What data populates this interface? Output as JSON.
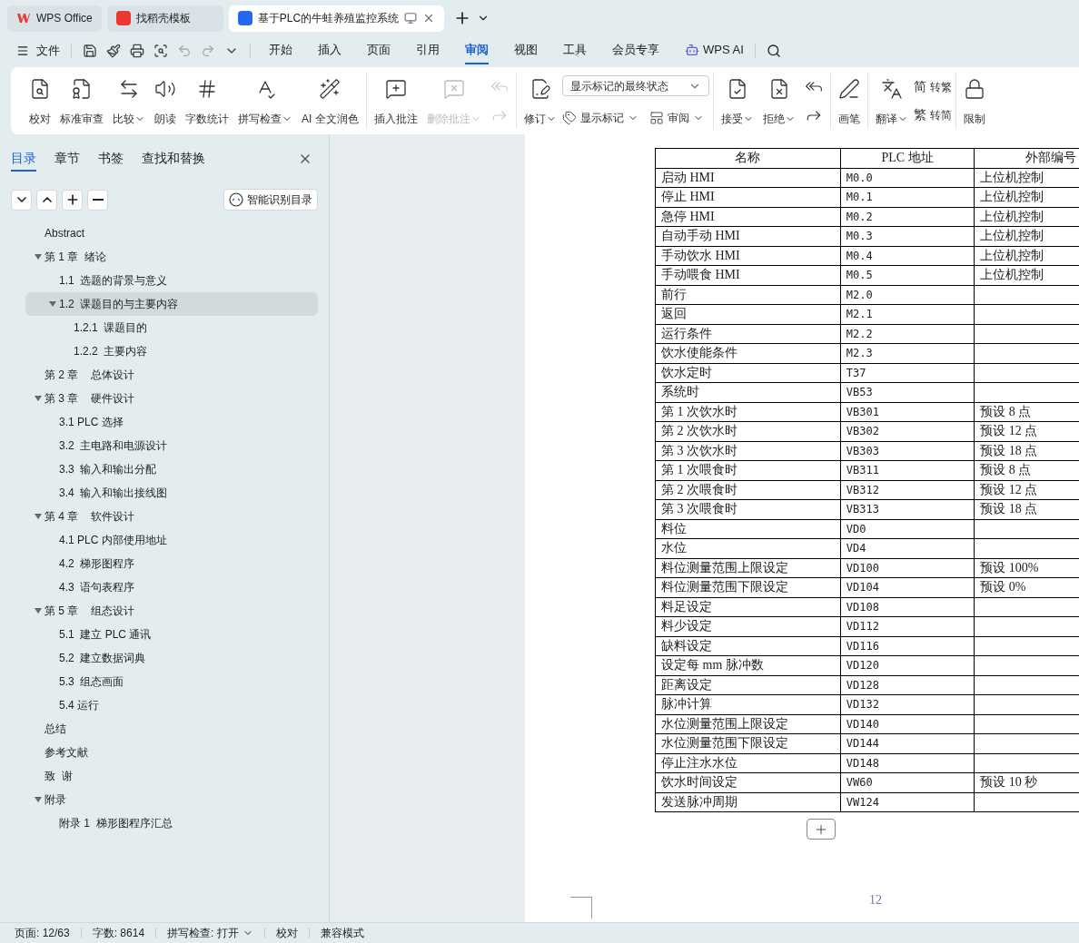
{
  "title_tabs": [
    {
      "label": "WPS Office",
      "selected": false
    },
    {
      "label": "找稻壳模板",
      "selected": false
    },
    {
      "label": "基于PLC的牛蛙养殖监控系统",
      "selected": true
    }
  ],
  "menu": {
    "file": "文件",
    "tabs": [
      {
        "label": "开始",
        "selected": false
      },
      {
        "label": "插入",
        "selected": false
      },
      {
        "label": "页面",
        "selected": false
      },
      {
        "label": "引用",
        "selected": false
      },
      {
        "label": "审阅",
        "selected": true
      },
      {
        "label": "视图",
        "selected": false
      },
      {
        "label": "工具",
        "selected": false
      },
      {
        "label": "会员专享",
        "selected": false
      },
      {
        "label": "WPS AI",
        "selected": false
      }
    ]
  },
  "ribbon": [
    {
      "items": [
        {
          "kind": "big",
          "label": "校对",
          "dropdown": false,
          "disabled": false
        },
        {
          "kind": "big",
          "label": "标准审查",
          "dropdown": false,
          "disabled": false
        },
        {
          "kind": "big",
          "label": "比较",
          "dropdown": true,
          "disabled": false
        },
        {
          "kind": "big",
          "label": "朗读",
          "dropdown": false,
          "disabled": false
        },
        {
          "kind": "big",
          "label": "字数统计",
          "dropdown": false,
          "disabled": false
        },
        {
          "kind": "big",
          "label": "拼写检查",
          "dropdown": true,
          "disabled": false
        },
        {
          "kind": "big",
          "label": "AI 全文润色",
          "dropdown": false,
          "disabled": false
        }
      ]
    },
    {
      "items": [
        {
          "kind": "big",
          "label": "插入批注",
          "dropdown": false,
          "disabled": false
        },
        {
          "kind": "big",
          "label": "删除批注",
          "dropdown": true,
          "disabled": true
        },
        {
          "kind": "icons",
          "disabled": true
        }
      ]
    },
    {
      "items": [
        {
          "kind": "big",
          "label": "修订",
          "dropdown": true,
          "disabled": false
        },
        {
          "kind": "select",
          "value": "显示标记的最终状态",
          "buttons": [
            {
              "label": "显示标记",
              "dropdown": true
            },
            {
              "label": "审阅",
              "dropdown": true
            }
          ]
        }
      ]
    },
    {
      "items": [
        {
          "kind": "big",
          "label": "接受",
          "dropdown": true,
          "disabled": false
        },
        {
          "kind": "big",
          "label": "拒绝",
          "dropdown": true,
          "disabled": false
        },
        {
          "kind": "icons",
          "disabled": false
        }
      ]
    },
    {
      "items": [
        {
          "kind": "big",
          "label": "画笔",
          "dropdown": false,
          "disabled": false
        }
      ]
    },
    {
      "items": [
        {
          "kind": "big",
          "label": "翻译",
          "dropdown": true,
          "disabled": false
        },
        {
          "kind": "convert",
          "buttons": [
            {
              "glyph": "简",
              "label": "转繁"
            },
            {
              "glyph": "繁",
              "label": "转简"
            }
          ]
        }
      ]
    },
    {
      "items": [
        {
          "kind": "big",
          "label": "限制",
          "dropdown": false,
          "disabled": false
        }
      ]
    }
  ],
  "sidebar": {
    "tabs": [
      {
        "label": "目录",
        "selected": true
      },
      {
        "label": "章节",
        "selected": false
      },
      {
        "label": "书签",
        "selected": false
      },
      {
        "label": "查找和替换",
        "selected": false
      }
    ],
    "smart_button": "智能识别目录",
    "toc": [
      {
        "label": "Abstract",
        "selected": false
      },
      {
        "label": "第 1 章  绪论",
        "expanded": true,
        "selected": false,
        "children": [
          {
            "label": "1.1  选题的背景与意义",
            "selected": false
          },
          {
            "label": "1.2  课题目的与主要内容",
            "expanded": true,
            "selected": true,
            "children": [
              {
                "label": "1.2.1  课题目的",
                "selected": false
              },
              {
                "label": "1.2.2  主要内容",
                "selected": false
              }
            ]
          }
        ]
      },
      {
        "label": "第 2 章    总体设计",
        "selected": false
      },
      {
        "label": "第 3 章    硬件设计",
        "expanded": true,
        "selected": false,
        "children": [
          {
            "label": "3.1 PLC 选择",
            "selected": false
          },
          {
            "label": "3.2  主电路和电源设计",
            "selected": false
          },
          {
            "label": "3.3  输入和输出分配",
            "selected": false
          },
          {
            "label": "3.4  输入和输出接线图",
            "selected": false
          }
        ]
      },
      {
        "label": "第 4 章    软件设计",
        "expanded": true,
        "selected": false,
        "children": [
          {
            "label": "4.1 PLC 内部使用地址",
            "selected": false
          },
          {
            "label": "4.2  梯形图程序",
            "selected": false
          },
          {
            "label": "4.3  语句表程序",
            "selected": false
          }
        ]
      },
      {
        "label": "第 5 章    组态设计",
        "expanded": true,
        "selected": false,
        "children": [
          {
            "label": "5.1  建立 PLC 通讯",
            "selected": false
          },
          {
            "label": "5.2  建立数据词典",
            "selected": false
          },
          {
            "label": "5.3  组态画面",
            "selected": false
          },
          {
            "label": "5.4 运行",
            "selected": false
          }
        ]
      },
      {
        "label": "总结",
        "selected": false
      },
      {
        "label": "参考文献",
        "selected": false
      },
      {
        "label": "致  谢",
        "selected": false
      },
      {
        "label": "附录",
        "expanded": true,
        "selected": false,
        "children": [
          {
            "label": "附录 1  梯形图程序汇总",
            "selected": false
          }
        ]
      }
    ]
  },
  "table": {
    "columns": [
      "名称",
      "PLC 地址",
      "外部编号"
    ],
    "rows": [
      [
        "启动 HMI",
        "M0.0",
        "上位机控制"
      ],
      [
        "停止 HMI",
        "M0.1",
        "上位机控制"
      ],
      [
        "急停 HMI",
        "M0.2",
        "上位机控制"
      ],
      [
        "自动手动 HMI",
        "M0.3",
        "上位机控制"
      ],
      [
        "手动饮水 HMI",
        "M0.4",
        "上位机控制"
      ],
      [
        "手动喂食 HMI",
        "M0.5",
        "上位机控制"
      ],
      [
        "前行",
        "M2.0"
      ],
      [
        "返回",
        "M2.1"
      ],
      [
        "运行条件",
        "M2.2"
      ],
      [
        "饮水使能条件",
        "M2.3"
      ],
      [
        "饮水定时",
        "T37"
      ],
      [
        "系统时",
        "VB53"
      ],
      [
        "第 1 次饮水时",
        "VB301",
        "预设 8 点"
      ],
      [
        "第 2 次饮水时",
        "VB302",
        "预设 12 点"
      ],
      [
        "第 3 次饮水时",
        "VB303",
        "预设 18 点"
      ],
      [
        "第 1 次喂食时",
        "VB311",
        "预设 8 点"
      ],
      [
        "第 2 次喂食时",
        "VB312",
        "预设 12 点"
      ],
      [
        "第 3 次喂食时",
        "VB313",
        "预设 18 点"
      ],
      [
        "料位",
        "VD0"
      ],
      [
        "水位",
        "VD4"
      ],
      [
        "料位测量范围上限设定",
        "VD100",
        "预设 100%"
      ],
      [
        "料位测量范围下限设定",
        "VD104",
        "预设 0%"
      ],
      [
        "料足设定",
        "VD108"
      ],
      [
        "料少设定",
        "VD112"
      ],
      [
        "缺料设定",
        "VD116"
      ],
      [
        "设定每 mm 脉冲数",
        "VD120"
      ],
      [
        "距离设定",
        "VD128"
      ],
      [
        "脉冲计算",
        "VD132"
      ],
      [
        "水位测量范围上限设定",
        "VD140"
      ],
      [
        "水位测量范围下限设定",
        "VD144"
      ],
      [
        "停止注水水位",
        "VD148"
      ],
      [
        "饮水时间设定",
        "VW60",
        "预设 10 秒"
      ],
      [
        "发送脉冲周期",
        "VW124"
      ]
    ]
  },
  "page_number": "12",
  "status_bar": [
    {
      "label": "页面: 12/63",
      "dropdown": false
    },
    {
      "label": "字数: 8614",
      "dropdown": false
    },
    {
      "label": "拼写检查: 打开",
      "dropdown": true
    },
    {
      "label": "校对",
      "dropdown": false
    },
    {
      "label": "兼容模式",
      "dropdown": false
    }
  ]
}
